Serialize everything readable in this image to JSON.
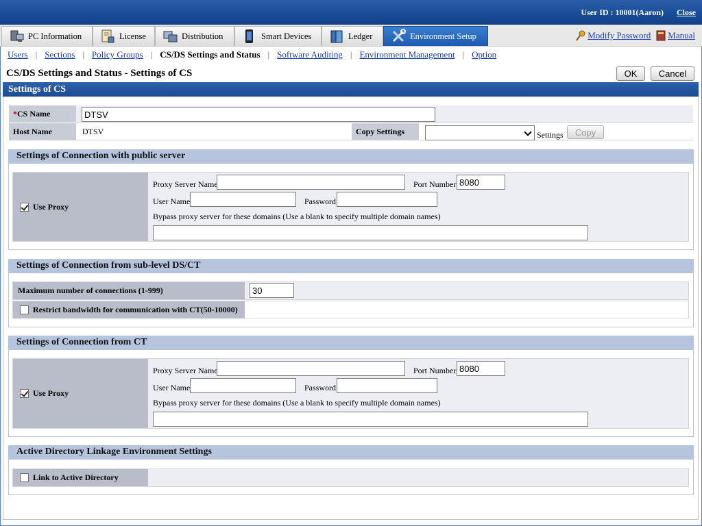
{
  "topbar": {
    "user_id": "User ID : 10001(Aaron)",
    "close": "Close"
  },
  "main_tabs": [
    {
      "label": "PC Information",
      "icon": "pc-icon"
    },
    {
      "label": "License",
      "icon": "license-icon"
    },
    {
      "label": "Distribution",
      "icon": "distribution-icon"
    },
    {
      "label": "Smart Devices",
      "icon": "smart-device-icon"
    },
    {
      "label": "Ledger",
      "icon": "ledger-icon"
    },
    {
      "label": "Environment Setup",
      "icon": "tools-icon"
    }
  ],
  "nav_links": {
    "modify_password": "Modify Password",
    "manual": "Manual"
  },
  "sub_nav": [
    "Users",
    "Sections",
    "Policy Groups",
    "CS/DS Settings and Status",
    "Software Auditing",
    "Environment Management",
    "Option"
  ],
  "page": {
    "title": "CS/DS Settings and Status - Settings of CS",
    "ok": "OK",
    "cancel": "Cancel",
    "section_title": "Settings of CS"
  },
  "cs": {
    "name_label": "CS Name",
    "required_mark": "*",
    "name_value": "DTSV",
    "host_label": "Host Name",
    "host_value": "DTSV",
    "copy_label": "Copy Settings",
    "copy_suffix": "Settings",
    "copy_button": "Copy"
  },
  "public_server": {
    "title": "Settings of Connection with public server",
    "use_proxy": "Use Proxy",
    "use_proxy_checked": true,
    "proxy_server_label": "Proxy Server Name",
    "proxy_server_value": "",
    "port_label": "Port Number",
    "port_value": "8080",
    "user_label": "User Name",
    "user_value": "",
    "password_label": "Password",
    "password_value": "",
    "bypass_label": "Bypass proxy server for these domains (Use a blank to specify multiple domain names)",
    "bypass_value": ""
  },
  "sublevel": {
    "title": "Settings of Connection from sub-level DS/CT",
    "max_conn_label": "Maximum number of connections (1-999)",
    "max_conn_value": "30",
    "restrict_label": "Restrict bandwidth for communication with CT(50-10000)",
    "restrict_checked": false
  },
  "from_ct": {
    "title": "Settings of Connection from CT",
    "use_proxy": "Use Proxy",
    "use_proxy_checked": true,
    "proxy_server_label": "Proxy Server Name",
    "proxy_server_value": "",
    "port_label": "Port Number",
    "port_value": "8080",
    "user_label": "User Name",
    "user_value": "",
    "password_label": "Password",
    "password_value": "",
    "bypass_label": "Bypass proxy server for these domains (Use a blank to specify multiple domain names)",
    "bypass_value": ""
  },
  "ad": {
    "title": "Active Directory Linkage Environment Settings",
    "link_label": "Link to Active Directory",
    "link_checked": false
  }
}
